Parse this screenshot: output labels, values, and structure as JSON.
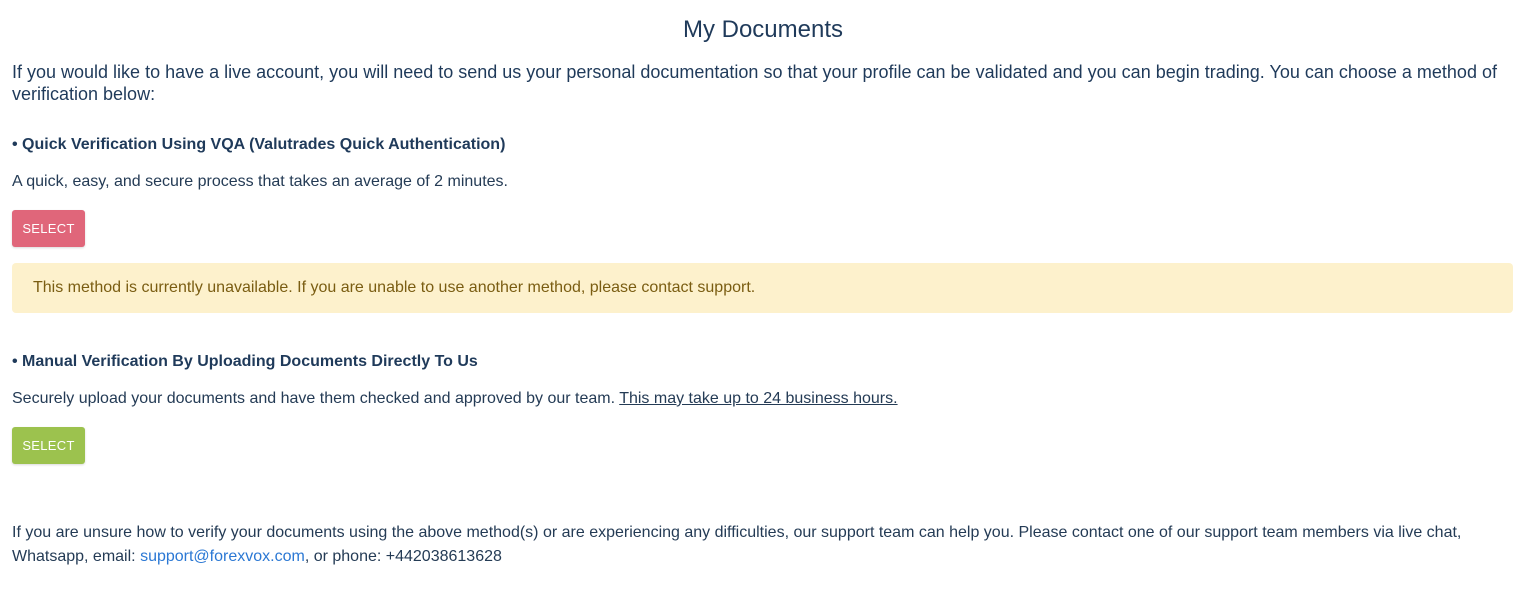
{
  "page": {
    "title": "My Documents",
    "intro": "If you would like to have a live account, you will need to send us your personal documentation so that your profile can be validated and you can begin trading. You can choose a method of verification below:"
  },
  "methods": [
    {
      "heading": "• Quick Verification Using VQA (Valutrades Quick Authentication)",
      "description": "A quick, easy, and secure process that takes an average of 2 minutes.",
      "button_label": "SELECT",
      "button_color": "#e0667a",
      "alert": "This method is currently unavailable. If you are unable to use another method, please contact support."
    },
    {
      "heading": "• Manual Verification By Uploading Documents Directly To Us",
      "description": "Securely upload your documents and have them checked and approved by our team. ",
      "note": "This may take up to 24 business hours.",
      "button_label": "SELECT",
      "button_color": "#9cc24e"
    }
  ],
  "footer": {
    "text_before_email": "If you are unsure how to verify your documents using the above method(s) or are experiencing any difficulties, our support team can help you. Please contact one of our support team members via live chat, Whatsapp, email: ",
    "email": "support@forexvox.com",
    "text_after_email": ", or phone: +442038613628"
  },
  "colors": {
    "alert_background": "#fdf1cc",
    "link": "#2b78d4"
  }
}
